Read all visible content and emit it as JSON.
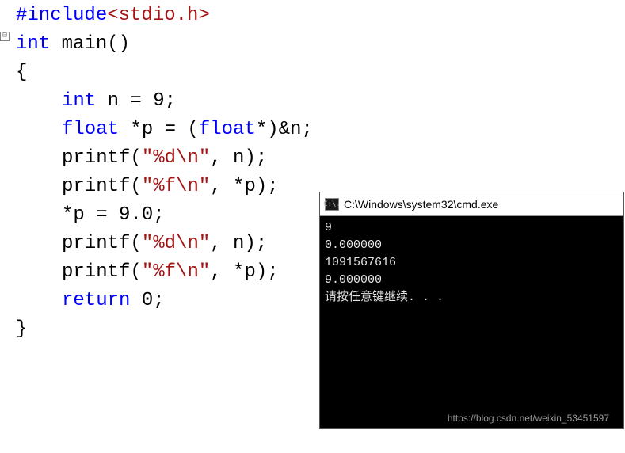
{
  "code": {
    "include": "#include",
    "include_header": "<stdio.h>",
    "int": "int",
    "float": "float",
    "ret": "return",
    "main_sig": " main()",
    "brace_open": "{",
    "brace_close": "}",
    "l4_a": " n = ",
    "l4_b": "9",
    "l4_c": ";",
    "l5_a": " *p = (",
    "l5_b": "*)&n;",
    "l6_a": "printf(",
    "l6_str": "\"%d\\n\"",
    "l6_b": ", n);",
    "l7_a": "printf(",
    "l7_str": "\"%f\\n\"",
    "l7_b": ", *p);",
    "l8": "*p = 9.0;",
    "l9_a": "printf(",
    "l9_str": "\"%d\\n\"",
    "l9_b": ", n);",
    "l10_a": "printf(",
    "l10_str": "\"%f\\n\"",
    "l10_b": ", *p);",
    "l11_a": " 0;",
    "collapse": "⊟"
  },
  "console": {
    "icon_text": "C:\\.",
    "title": "C:\\Windows\\system32\\cmd.exe",
    "lines": [
      "9",
      "0.000000",
      "1091567616",
      "9.000000",
      "请按任意键继续. . ."
    ]
  },
  "watermark": "https://blog.csdn.net/weixin_53451597"
}
